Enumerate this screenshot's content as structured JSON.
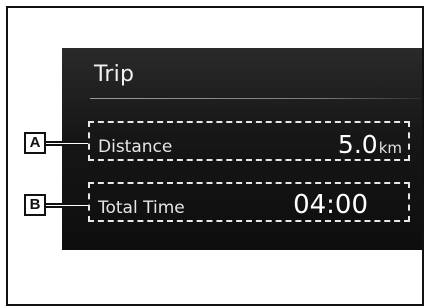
{
  "screen": {
    "title": "Trip",
    "rows": [
      {
        "callout": "A",
        "label": "Distance",
        "value": "5.0",
        "unit": "km"
      },
      {
        "callout": "B",
        "label": "Total Time",
        "value": "04:00"
      }
    ]
  },
  "colors": {
    "screen_background": "#161616",
    "text": "#f0f0f0",
    "dashed_outline": "#e8e8e8",
    "callout_border": "#111111"
  }
}
